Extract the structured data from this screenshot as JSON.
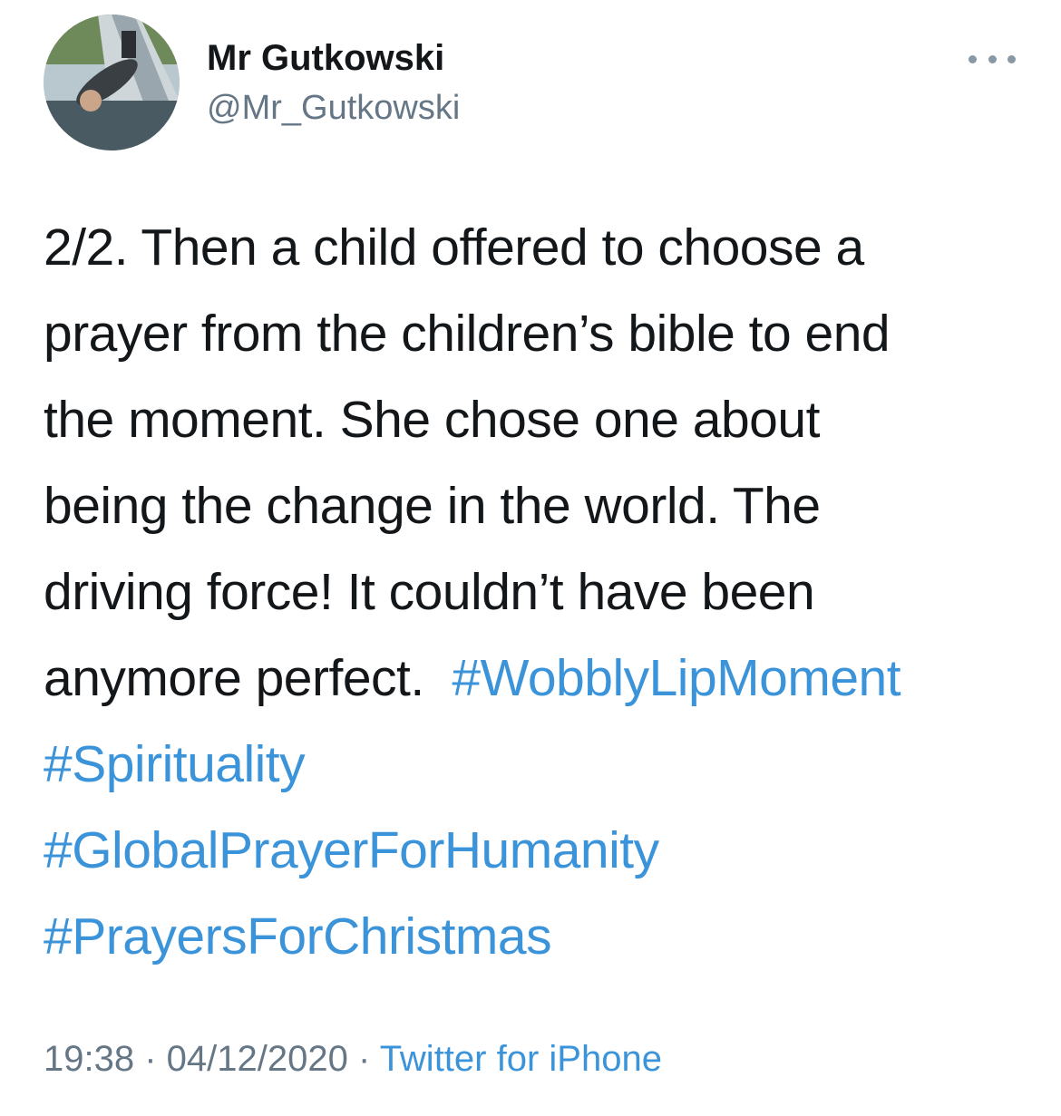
{
  "author": {
    "name": "Mr Gutkowski",
    "handle": "@Mr_Gutkowski",
    "avatar_icon": "profile-photo"
  },
  "more_icon": "more-horizontal-icon",
  "tweet": {
    "lines": [
      "2/2. Then a child offered to choose a",
      "prayer from the children’s bible to end",
      "the moment.  She chose one about",
      "being the change in the world.  The",
      "driving force! It couldn’t have been",
      "anymore perfect.  "
    ],
    "hashtags": [
      "#WobblyLipMoment",
      "#Spirituality",
      "#GlobalPrayerForHumanity",
      "#PrayersForChristmas"
    ]
  },
  "meta": {
    "time": "19:38",
    "separator": " · ",
    "date": "04/12/2020",
    "source": "Twitter for iPhone"
  },
  "colors": {
    "text": "#14171a",
    "secondary": "#657786",
    "link": "#3b94d9"
  }
}
